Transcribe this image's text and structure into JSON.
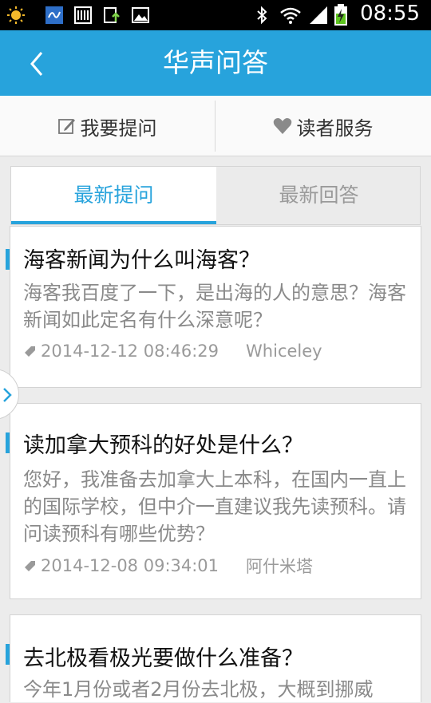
{
  "status_bar": {
    "time": "08:55",
    "icons": [
      "weather-sun-icon",
      "app-icon",
      "barcode-icon",
      "upload-icon",
      "image-icon",
      "bluetooth-icon",
      "wifi-icon",
      "signal-icon",
      "battery-charging-icon"
    ]
  },
  "app_bar": {
    "title": "华声问答",
    "back_icon": "chevron-left-icon"
  },
  "actions": {
    "ask_label": "我要提问",
    "service_label": "读者服务"
  },
  "tabs": [
    {
      "label": "最新提问",
      "active": true
    },
    {
      "label": "最新回答",
      "active": false
    }
  ],
  "questions": [
    {
      "title": "海客新闻为什么叫海客？",
      "body": "海客我百度了一下，是出海的人的意思？海客新闻如此定名有什么深意呢？",
      "timestamp": "2014-12-12 08:46:29",
      "author": "Whiceley"
    },
    {
      "title": "读加拿大预科的好处是什么？",
      "body": "您好，我准备去加拿大上本科，在国内一直上的国际学校，但中介一直建议我先读预科。请问读预科有哪些优势？",
      "timestamp": "2014-12-08 09:34:01",
      "author": "阿什米塔"
    },
    {
      "title": "去北极看极光要做什么准备？",
      "body": "今年1月份或者2月份去北极，大概到挪威",
      "timestamp": "",
      "author": ""
    }
  ],
  "colors": {
    "accent": "#27a3dc",
    "status_bar": "#000000",
    "background": "#ececec"
  }
}
